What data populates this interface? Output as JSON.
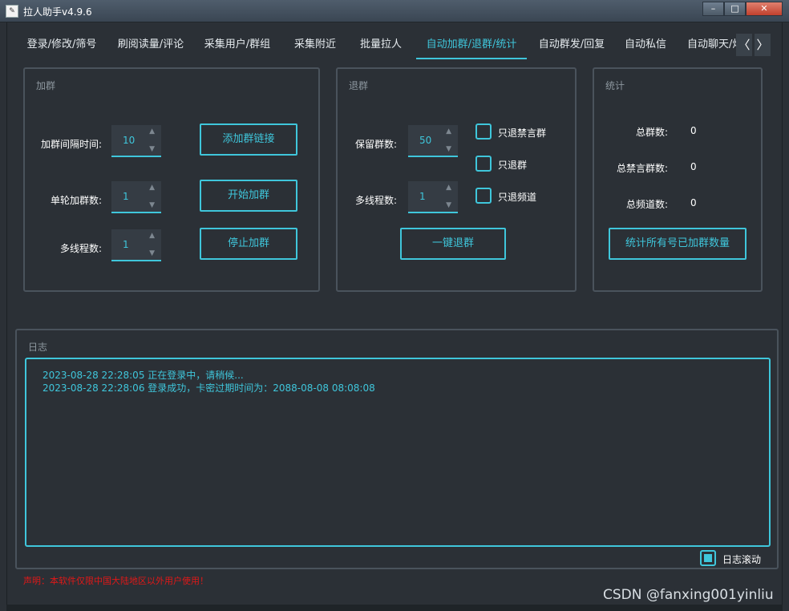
{
  "window": {
    "title": "拉人助手v4.9.6",
    "icon": "app-icon",
    "buttons": [
      "minimize",
      "maximize",
      "close"
    ]
  },
  "tabs": [
    {
      "label": "登录/修改/筛号",
      "active": false
    },
    {
      "label": "刷阅读量/评论",
      "active": false
    },
    {
      "label": "采集用户/群组",
      "active": false
    },
    {
      "label": "采集附近",
      "active": false
    },
    {
      "label": "批量拉人",
      "active": false
    },
    {
      "label": "自动加群/退群/统计",
      "active": true
    },
    {
      "label": "自动群发/回复",
      "active": false
    },
    {
      "label": "自动私信",
      "active": false
    },
    {
      "label": "自动聊天/炒",
      "active": false
    }
  ],
  "tab_scroll": {
    "left": "〈",
    "right": "〉"
  },
  "join_group": {
    "title": "加群",
    "interval_label": "加群间隔时间:",
    "interval_value": "10",
    "per_round_label": "单轮加群数:",
    "per_round_value": "1",
    "threads_label": "多线程数:",
    "threads_value": "1",
    "add_link_button": "添加群链接",
    "start_button": "开始加群",
    "stop_button": "停止加群"
  },
  "leave_group": {
    "title": "退群",
    "keep_label": "保留群数:",
    "keep_value": "50",
    "threads_label": "多线程数:",
    "threads_value": "1",
    "only_muted_label": "只退禁言群",
    "only_group_label": "只退群",
    "only_channel_label": "只退频道",
    "leave_all_button": "一键退群"
  },
  "stats": {
    "title": "统计",
    "total_groups_label": "总群数:",
    "total_groups_value": "0",
    "total_muted_label": "总禁言群数:",
    "total_muted_value": "0",
    "total_channels_label": "总频道数:",
    "total_channels_value": "0",
    "count_button": "统计所有号已加群数量"
  },
  "log": {
    "title": "日志",
    "lines": [
      "2023-08-28 22:28:05 正在登录中，请稍候...",
      "2023-08-28 22:28:06 登录成功，卡密过期时间为：2088-08-08 08:08:08"
    ],
    "autoscroll_label": "日志滚动",
    "autoscroll_checked": true
  },
  "footer_warning": "声明：本软件仅限中国大陆地区以外用户使用！",
  "watermark": "CSDN @fanxing001yinliu",
  "colors": {
    "accent": "#3fc6db",
    "background": "#2b3036",
    "warning": "#e01818"
  }
}
